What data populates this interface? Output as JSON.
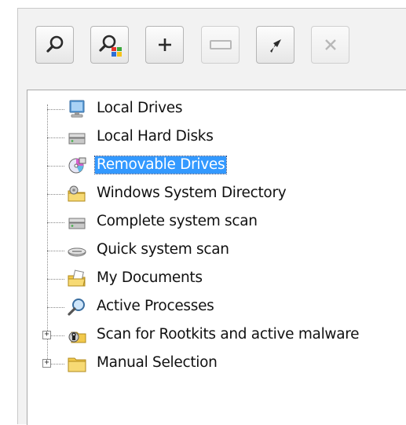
{
  "toolbar": {
    "buttons": [
      {
        "name": "scan-button",
        "icon": "magnifier-icon",
        "enabled": true
      },
      {
        "name": "scan-profile-button",
        "icon": "magnifier-windows-icon",
        "enabled": true
      },
      {
        "name": "add-button",
        "icon": "plus-icon",
        "enabled": true
      },
      {
        "name": "rename-button",
        "icon": "rename-field-icon",
        "enabled": false
      },
      {
        "name": "shortcut-button",
        "icon": "shortcut-arrow-icon",
        "enabled": true
      },
      {
        "name": "delete-button",
        "icon": "close-icon",
        "enabled": false
      }
    ]
  },
  "tree": {
    "items": [
      {
        "label": "Local Drives",
        "icon": "monitor-icon",
        "expandable": false,
        "selected": false
      },
      {
        "label": "Local Hard Disks",
        "icon": "hard-disk-icon",
        "expandable": false,
        "selected": false
      },
      {
        "label": "Removable Drives",
        "icon": "removable-drive-icon",
        "expandable": false,
        "selected": true
      },
      {
        "label": "Windows System Directory",
        "icon": "system-folder-icon",
        "expandable": false,
        "selected": false
      },
      {
        "label": "Complete system scan",
        "icon": "hard-disk-icon",
        "expandable": false,
        "selected": false
      },
      {
        "label": "Quick system scan",
        "icon": "disk-drive-icon",
        "expandable": false,
        "selected": false
      },
      {
        "label": "My Documents",
        "icon": "documents-folder-icon",
        "expandable": false,
        "selected": false
      },
      {
        "label": "Active Processes",
        "icon": "magnifier-icon",
        "expandable": false,
        "selected": false
      },
      {
        "label": "Scan for Rootkits and active malware",
        "icon": "rootkit-scan-icon",
        "expandable": true,
        "selected": false
      },
      {
        "label": "Manual Selection",
        "icon": "folder-icon",
        "expandable": true,
        "selected": false
      }
    ],
    "expander_symbol": "+"
  },
  "colors": {
    "selection": "#3399ff",
    "frame": "#f2f2f2"
  }
}
